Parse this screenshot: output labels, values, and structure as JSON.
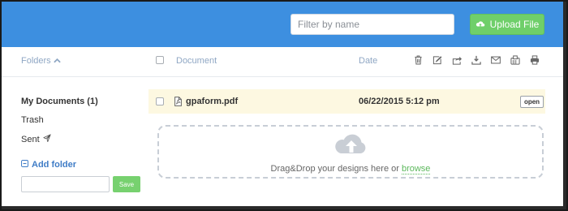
{
  "topbar": {
    "filter_placeholder": "Filter by name",
    "upload_label": "Upload File",
    "accent_color": "#3d8fe0",
    "upload_color": "#6fcf6a"
  },
  "table_header": {
    "folders_label": "Folders",
    "document_label": "Document",
    "date_label": "Date",
    "toolbar_icons": [
      "trash-icon",
      "edit-icon",
      "share-icon",
      "download-icon",
      "email-icon",
      "fax-icon",
      "print-icon"
    ]
  },
  "sidebar": {
    "items": [
      {
        "label": "My Documents (1)",
        "active": true
      },
      {
        "label": "Trash",
        "active": false
      },
      {
        "label": "Sent",
        "active": false,
        "icon": "paper-plane-icon"
      }
    ],
    "add_folder_label": "Add folder",
    "save_label": "Save"
  },
  "documents": [
    {
      "name": "gpaform.pdf",
      "date": "06/22/2015 5:12 pm",
      "action": "open",
      "row_color": "#fdf8e1"
    }
  ],
  "dropzone": {
    "text": "Drag&Drop your designs here or",
    "browse_label": "browse"
  }
}
